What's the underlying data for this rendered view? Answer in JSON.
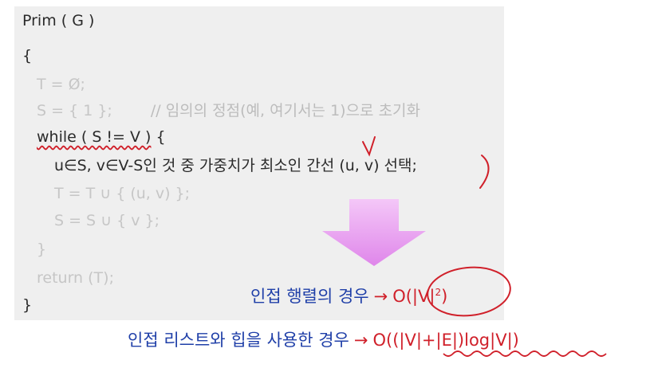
{
  "code": {
    "title": "Prim ( G )",
    "open_brace": "{",
    "line_T": "T = Ø;",
    "line_S": "S = { 1 };",
    "comment_S": "// 임의의 정점(예, 여기서는 1)으로 초기화",
    "while_kw": "while ( S != V )",
    "while_brace": " {",
    "select_line": "u∈S, v∈V-S인 것 중 가중치가 최소인 간선 (u, v) 선택;",
    "update_T": "T = T ∪ { (u, v) };",
    "update_S": "S = S ∪ { v };",
    "inner_close": "}",
    "return_line": "return (T);",
    "close_brace": "}"
  },
  "results": [
    {
      "label": "인접 행렬의 경우",
      "arrow": "→",
      "complexity_prefix": "O(|V|",
      "complexity_sup": "2",
      "complexity_suffix": ")"
    },
    {
      "label": "인접 리스트와 힙을 사용한 경우",
      "arrow": "→",
      "complexity": "O((|V|+|E|)log|V|)"
    }
  ],
  "colors": {
    "code_bg": "#efefef",
    "code_text": "#2a2a2a",
    "faded_text": "#c6c6c6",
    "label_blue": "#1f3fa8",
    "accent_red": "#d0202a",
    "arrow_fill": "#e9a3f2"
  }
}
